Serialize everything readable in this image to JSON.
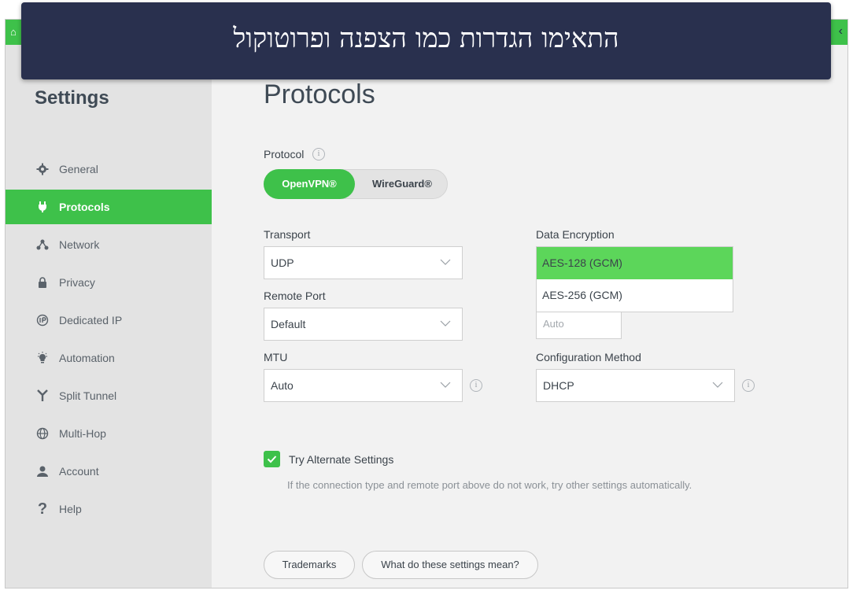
{
  "overlay": {
    "headline": "התאימו הגדרות כמו הצפנה ופרוטוקול"
  },
  "sidebar": {
    "title": "Settings",
    "items": [
      {
        "label": "General",
        "icon": "gear-icon",
        "active": false
      },
      {
        "label": "Protocols",
        "icon": "plug-icon",
        "active": true
      },
      {
        "label": "Network",
        "icon": "network-icon",
        "active": false
      },
      {
        "label": "Privacy",
        "icon": "lock-icon",
        "active": false
      },
      {
        "label": "Dedicated IP",
        "icon": "dedicated-ip-icon",
        "active": false
      },
      {
        "label": "Automation",
        "icon": "lightbulb-icon",
        "active": false
      },
      {
        "label": "Split Tunnel",
        "icon": "split-tunnel-icon",
        "active": false
      },
      {
        "label": "Multi-Hop",
        "icon": "globe-icon",
        "active": false
      },
      {
        "label": "Account",
        "icon": "user-icon",
        "active": false
      },
      {
        "label": "Help",
        "icon": "question-icon",
        "active": false
      }
    ]
  },
  "main": {
    "title": "Protocols",
    "protocol": {
      "label": "Protocol",
      "options": [
        "OpenVPN®",
        "WireGuard®"
      ],
      "selected": "OpenVPN®"
    },
    "transport": {
      "label": "Transport",
      "value": "UDP"
    },
    "data_encryption": {
      "label": "Data Encryption",
      "options": [
        "AES-128 (GCM)",
        "AES-256 (GCM)"
      ],
      "highlighted": "AES-128 (GCM)"
    },
    "remote_port": {
      "label": "Remote Port",
      "value": "Default"
    },
    "hidden_field": {
      "value": "Auto"
    },
    "mtu": {
      "label": "MTU",
      "value": "Auto"
    },
    "configuration_method": {
      "label": "Configuration Method",
      "value": "DHCP"
    },
    "try_alternate": {
      "label": "Try Alternate Settings",
      "checked": true,
      "hint": "If the connection type and remote port above do not work, try other settings automatically."
    },
    "buttons": {
      "trademarks": "Trademarks",
      "settings_help": "What do these settings mean?"
    }
  },
  "colors": {
    "accent": "#3ec14a",
    "highlight": "#5cd65a",
    "banner": "#29304e"
  }
}
